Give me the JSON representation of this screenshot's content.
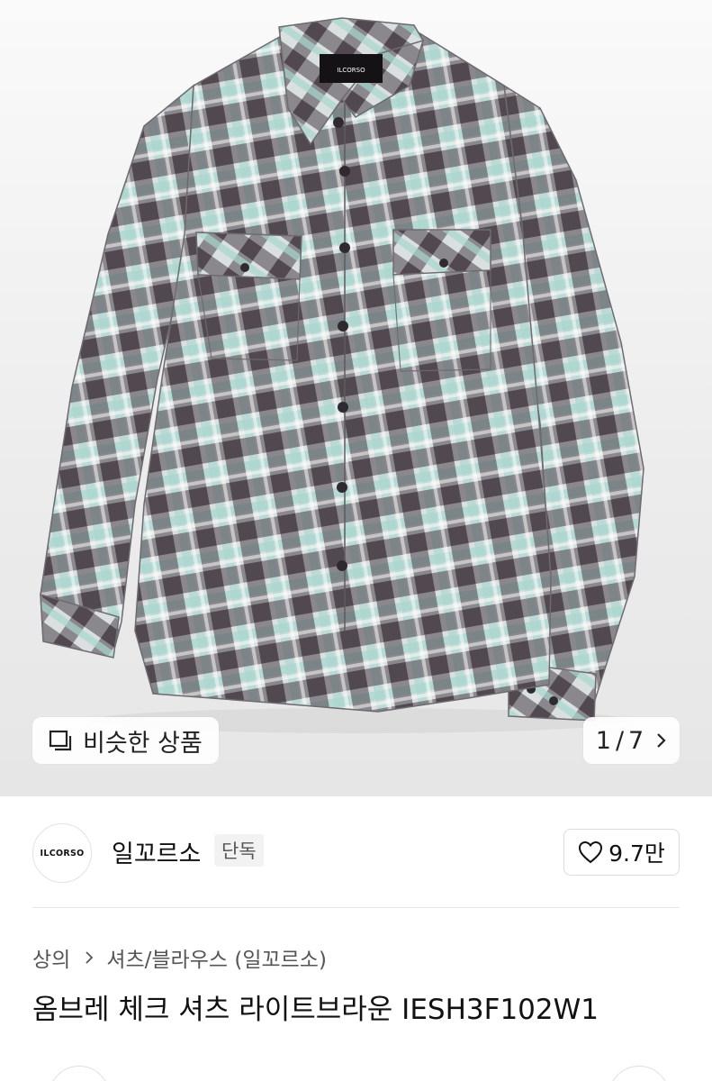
{
  "gallery": {
    "similar_label": "비슷한 상품",
    "current_index": "1",
    "separator": "/",
    "total": "7",
    "shirt_label": "ILCORSO"
  },
  "brand": {
    "logo_text": "ILCORSO",
    "name": "일꼬르소",
    "badge": "단독",
    "likes": "9.7만"
  },
  "breadcrumb": {
    "category": "상의",
    "subcategory": "셔츠/블라우스 (일꼬르소)"
  },
  "product": {
    "title": "옴브레 체크 셔츠 라이트브라운 IESH3F102W1"
  },
  "colors": {
    "check_dark": "#4a3f48",
    "check_mid": "#8d8a92",
    "check_light": "#d9e0df",
    "check_mint": "#a9d6cf"
  }
}
